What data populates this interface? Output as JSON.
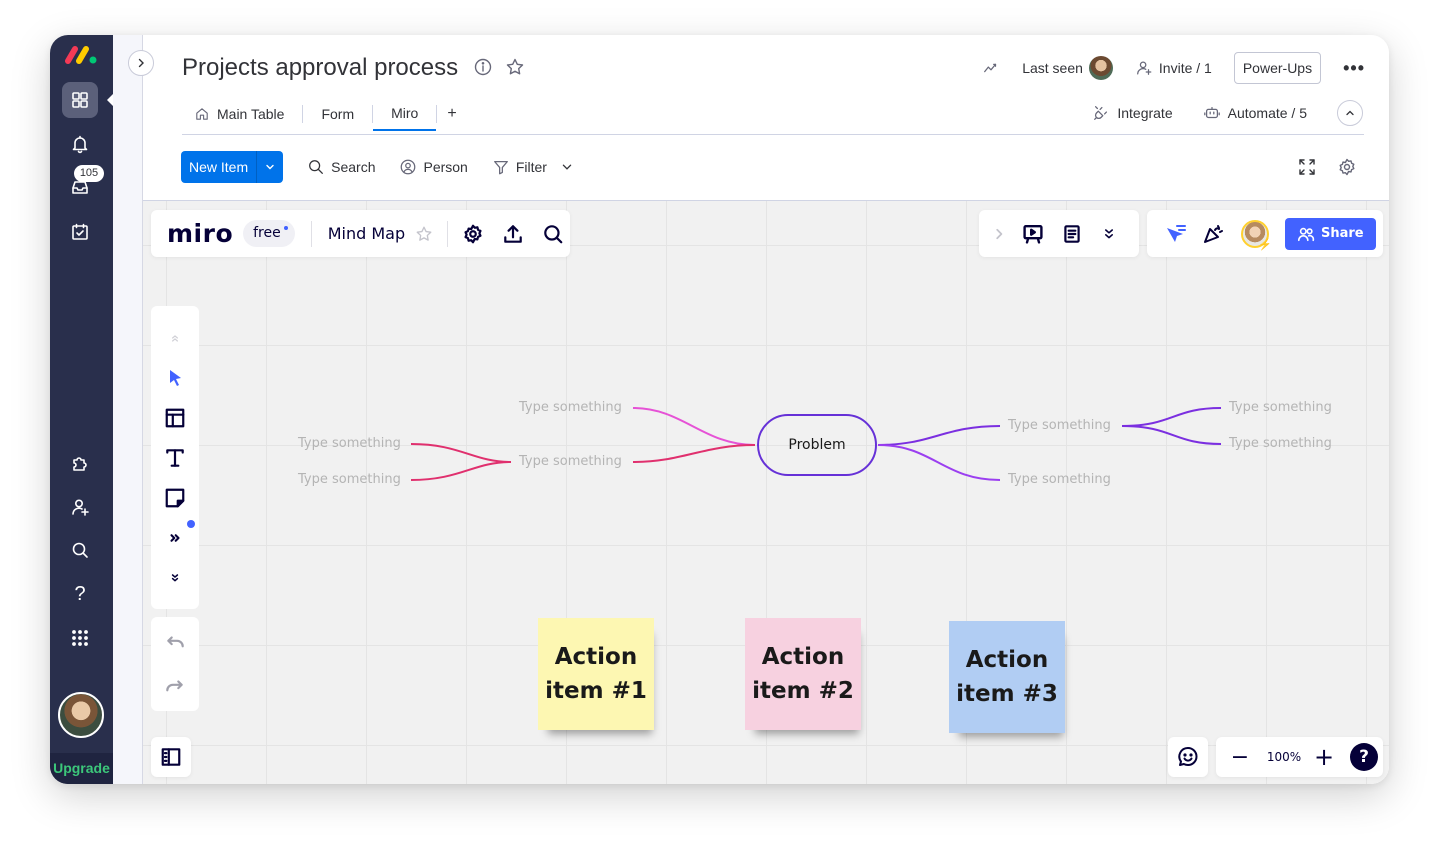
{
  "app": {
    "board_title": "Projects approval process",
    "nav_badge_count": "105",
    "upgrade_label": "Upgrade",
    "colors": {
      "nav_bg": "#292f4c",
      "primary": "#0073ea",
      "upgrade_green": "#3cc77a",
      "miro_share": "#4262ff"
    }
  },
  "leftnav": {
    "items": [
      {
        "icon": "workspace-grid-icon",
        "active": true
      },
      {
        "icon": "bell-icon"
      },
      {
        "icon": "inbox-icon"
      },
      {
        "icon": "calendar-check-icon"
      },
      {
        "icon": "puzzle-icon"
      },
      {
        "icon": "add-user-icon"
      },
      {
        "icon": "search-icon"
      },
      {
        "icon": "help-icon",
        "glyph": "?"
      },
      {
        "icon": "apps-grid-icon"
      }
    ]
  },
  "header": {
    "activity_icon": "activity-icon",
    "last_seen_label": "Last seen",
    "invite_label": "Invite / 1",
    "powerups_label": "Power-Ups",
    "more_label": "•••"
  },
  "tabs": {
    "items": [
      {
        "label": "Main Table",
        "icon": "home-icon",
        "active": false
      },
      {
        "label": "Form",
        "active": false
      },
      {
        "label": "Miro",
        "active": true
      }
    ],
    "add_label": "+",
    "integrate_label": "Integrate",
    "automate_label": "Automate / 5"
  },
  "toolbar": {
    "new_item_label": "New Item",
    "search_label": "Search",
    "person_label": "Person",
    "filter_label": "Filter"
  },
  "miro": {
    "logo": "miro",
    "plan_label": "free",
    "board_name": "Mind Map",
    "share_label": "Share",
    "zoom_level": "100%",
    "zoom_minus": "−",
    "zoom_plus": "+",
    "help_label": "?",
    "mindmap": {
      "center": "Problem",
      "left_branches": [
        {
          "label": "Type something",
          "children": []
        },
        {
          "label": "Type something",
          "children": [
            "Type something",
            "Type something"
          ]
        }
      ],
      "right_branches": [
        {
          "label": "Type something",
          "children": [
            "Type something",
            "Type something"
          ]
        },
        {
          "label": "Type something",
          "children": []
        }
      ],
      "colors": {
        "left_upper": "#e652d6",
        "left_lower": "#e0306e",
        "right": "#7b2fe0",
        "node_border": "#6631d7"
      }
    },
    "stickies": [
      {
        "line1": "Action",
        "line2": "item #1",
        "color": "#fdf7b2"
      },
      {
        "line1": "Action",
        "line2": "item #2",
        "color": "#f7d1e0"
      },
      {
        "line1": "Action",
        "line2": "item #3",
        "color": "#b1cdf3"
      }
    ]
  }
}
